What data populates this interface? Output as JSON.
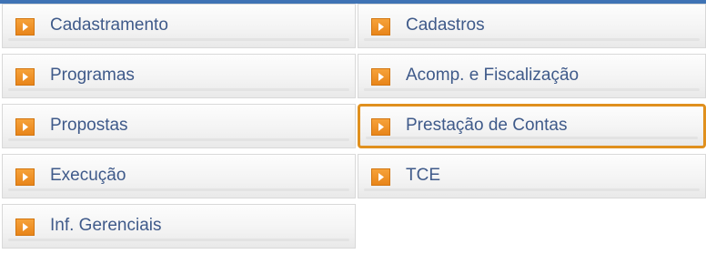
{
  "colors": {
    "accent": "#3f73b5",
    "arrow_orange": "#ef8f21",
    "label_blue": "#3f5a8a",
    "selected_border": "#e0901e"
  },
  "menu": {
    "left": [
      {
        "label": "Cadastramento",
        "icon": "orange-play-icon"
      },
      {
        "label": "Programas",
        "icon": "orange-play-icon"
      },
      {
        "label": "Propostas",
        "icon": "orange-play-icon"
      },
      {
        "label": "Execução",
        "icon": "orange-play-icon"
      },
      {
        "label": "Inf. Gerenciais",
        "icon": "orange-play-icon"
      }
    ],
    "right": [
      {
        "label": "Cadastros",
        "icon": "orange-play-icon"
      },
      {
        "label": "Acomp. e Fiscalização",
        "icon": "orange-play-icon"
      },
      {
        "label": "Prestação de Contas",
        "icon": "orange-play-icon",
        "selected": true
      },
      {
        "label": "TCE",
        "icon": "orange-play-icon"
      }
    ]
  }
}
